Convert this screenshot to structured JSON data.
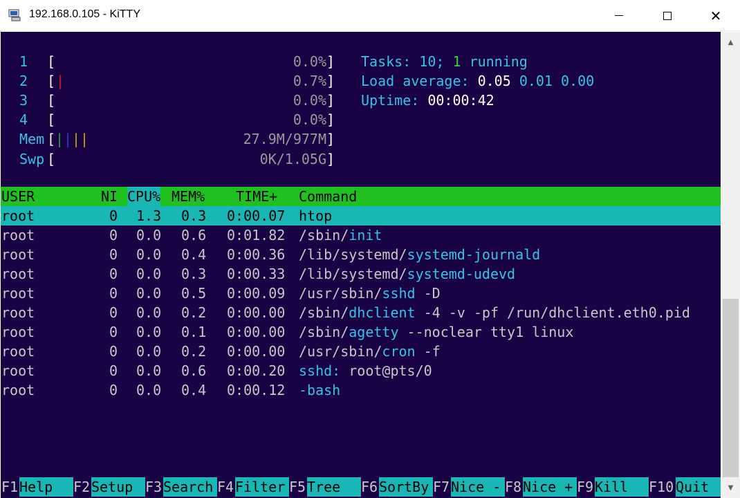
{
  "window": {
    "title": "192.168.0.105 - KiTTY",
    "minimize": "—",
    "close": "✕",
    "app_icon": "terminal-computer-icon"
  },
  "meters": {
    "cpus": [
      {
        "label": "1",
        "value": "0.0%"
      },
      {
        "label": "2",
        "value": "0.7%"
      },
      {
        "label": "3",
        "value": "0.0%"
      },
      {
        "label": "4",
        "value": "0.0%"
      }
    ],
    "mem": {
      "label": "Mem",
      "value": "27.9M/977M"
    },
    "swp": {
      "label": "Swp",
      "value": "0K/1.05G"
    },
    "open_bracket": "[",
    "close_bracket": "]"
  },
  "summary": {
    "tasks_label": "Tasks:",
    "tasks_count": "10;",
    "running_count": "1",
    "running_label": "running",
    "load_label": "Load average:",
    "load_1": "0.05",
    "load_5": "0.01",
    "load_15": "0.00",
    "uptime_label": "Uptime:",
    "uptime_value": "00:00:42"
  },
  "table": {
    "headers": {
      "user": "USER",
      "ni": "NI",
      "cpu": "CPU%",
      "mem": "MEM%",
      "time": "TIME+",
      "command": "Command"
    },
    "rows": [
      {
        "user": "root",
        "ni": "0",
        "cpu": "1.3",
        "mem": "0.3",
        "time": "0:00.07",
        "path": "",
        "prog": "htop",
        "args": ""
      },
      {
        "user": "root",
        "ni": "0",
        "cpu": "0.0",
        "mem": "0.6",
        "time": "0:01.82",
        "path": "/sbin/",
        "prog": "init",
        "args": ""
      },
      {
        "user": "root",
        "ni": "0",
        "cpu": "0.0",
        "mem": "0.4",
        "time": "0:00.36",
        "path": "/lib/systemd/",
        "prog": "systemd-journald",
        "args": ""
      },
      {
        "user": "root",
        "ni": "0",
        "cpu": "0.0",
        "mem": "0.3",
        "time": "0:00.33",
        "path": "/lib/systemd/",
        "prog": "systemd-udevd",
        "args": ""
      },
      {
        "user": "root",
        "ni": "0",
        "cpu": "0.0",
        "mem": "0.5",
        "time": "0:00.09",
        "path": "/usr/sbin/",
        "prog": "sshd",
        "args": " -D"
      },
      {
        "user": "root",
        "ni": "0",
        "cpu": "0.0",
        "mem": "0.2",
        "time": "0:00.00",
        "path": "/sbin/",
        "prog": "dhclient",
        "args": " -4 -v -pf /run/dhclient.eth0.pid"
      },
      {
        "user": "root",
        "ni": "0",
        "cpu": "0.0",
        "mem": "0.1",
        "time": "0:00.00",
        "path": "/sbin/",
        "prog": "agetty",
        "args": " --noclear tty1 linux"
      },
      {
        "user": "root",
        "ni": "0",
        "cpu": "0.0",
        "mem": "0.2",
        "time": "0:00.00",
        "path": "/usr/sbin/",
        "prog": "cron",
        "args": " -f"
      },
      {
        "user": "root",
        "ni": "0",
        "cpu": "0.0",
        "mem": "0.6",
        "time": "0:00.20",
        "path": "",
        "prog": "sshd:",
        "args": " root@pts/0"
      },
      {
        "user": "root",
        "ni": "0",
        "cpu": "0.0",
        "mem": "0.4",
        "time": "0:00.12",
        "path": "",
        "prog": "-bash",
        "args": ""
      }
    ]
  },
  "footer": [
    {
      "key": "F1",
      "label": "Help"
    },
    {
      "key": "F2",
      "label": "Setup"
    },
    {
      "key": "F3",
      "label": "Search"
    },
    {
      "key": "F4",
      "label": "Filter"
    },
    {
      "key": "F5",
      "label": "Tree"
    },
    {
      "key": "F6",
      "label": "SortBy"
    },
    {
      "key": "F7",
      "label": "Nice -"
    },
    {
      "key": "F8",
      "label": "Nice +"
    },
    {
      "key": "F9",
      "label": "Kill"
    },
    {
      "key": "F10",
      "label": "Quit"
    }
  ],
  "scrollbar": {
    "up": "▲",
    "down": "▼"
  }
}
